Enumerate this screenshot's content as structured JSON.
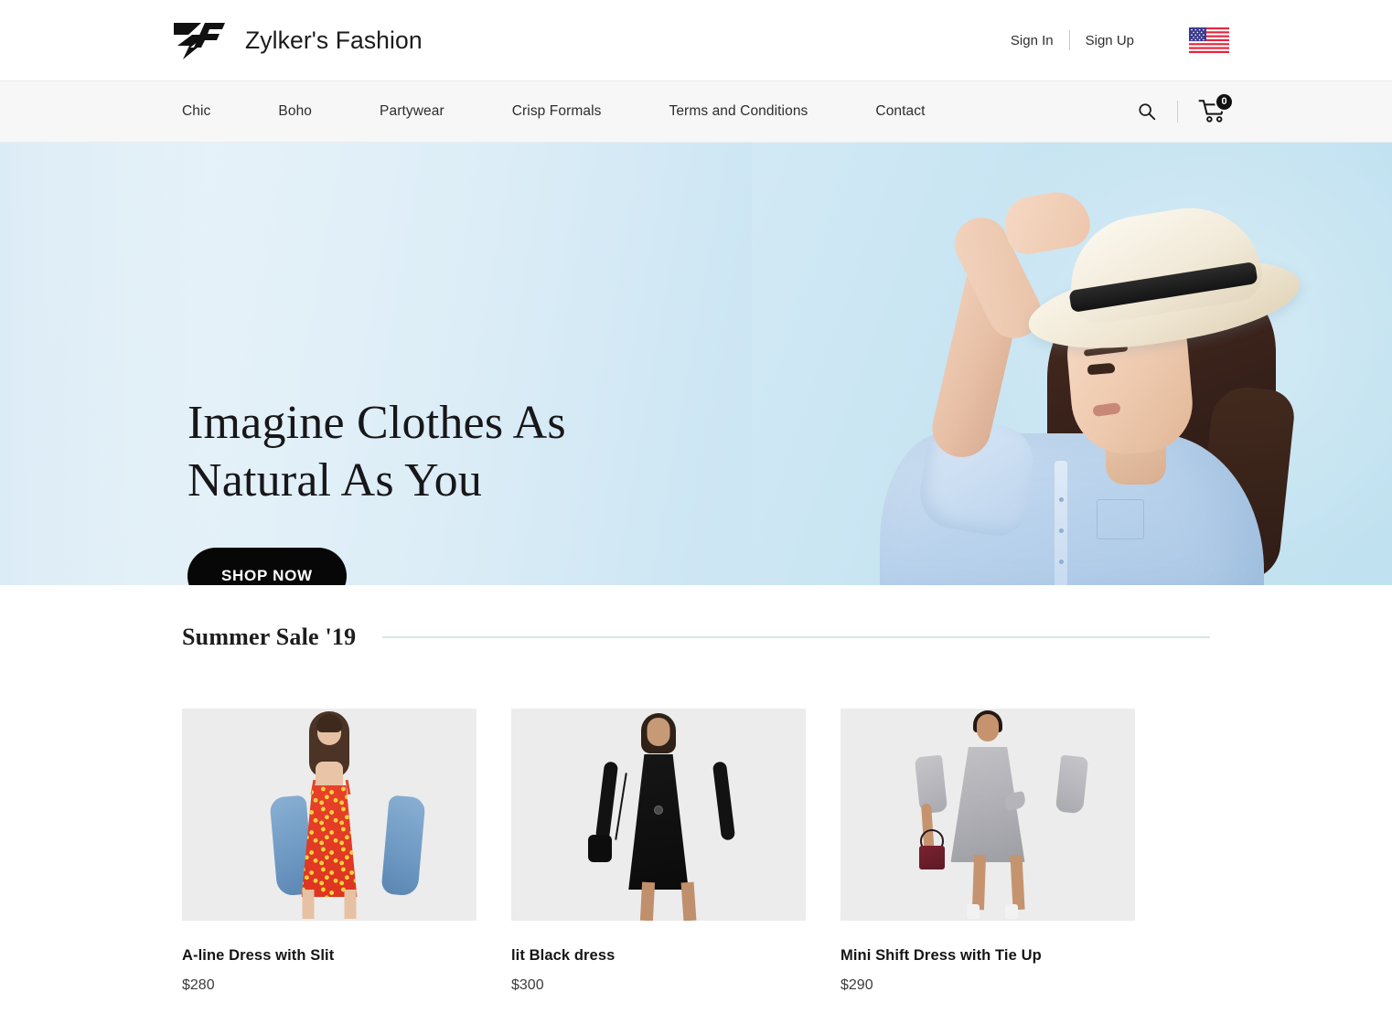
{
  "header": {
    "brand_name": "Zylker's Fashion",
    "logo_icon": "zf-monogram-logo",
    "sign_in": "Sign In",
    "sign_up": "Sign Up",
    "flag_icon": "us-flag-icon",
    "flag_label": "United States"
  },
  "nav": {
    "items": [
      {
        "label": "Chic"
      },
      {
        "label": "Boho"
      },
      {
        "label": "Partywear"
      },
      {
        "label": "Crisp Formals"
      },
      {
        "label": "Terms and Conditions"
      },
      {
        "label": "Contact"
      }
    ],
    "search_icon": "search-icon",
    "cart_icon": "shopping-cart-icon",
    "cart_count": "0"
  },
  "hero": {
    "title_line1": "Imagine Clothes As",
    "title_line2": "Natural As You",
    "cta_label": "SHOP NOW",
    "image_alt": "Woman in light blue denim shirt wearing a straw fedora hat"
  },
  "sale": {
    "section_title": "Summer Sale '19",
    "products": [
      {
        "title": "A-line Dress with Slit",
        "price": "$280",
        "image_alt": "Model in red floral mini dress with denim jacket"
      },
      {
        "title": "lit Black dress",
        "price": "$300",
        "image_alt": "Model in black V-neck dress with small black bag"
      },
      {
        "title": "Mini Shift Dress with Tie Up",
        "price": "$290",
        "image_alt": "Model in grey tie-up shift dress with burgundy handbag"
      }
    ]
  },
  "colors": {
    "accent_black": "#070707",
    "nav_background": "#f7f7f7",
    "hero_gradient_start": "#e9f3f9",
    "hero_gradient_end": "#c6e4f1",
    "section_rule": "#d5e8e2",
    "product_bg": "#ececec"
  }
}
